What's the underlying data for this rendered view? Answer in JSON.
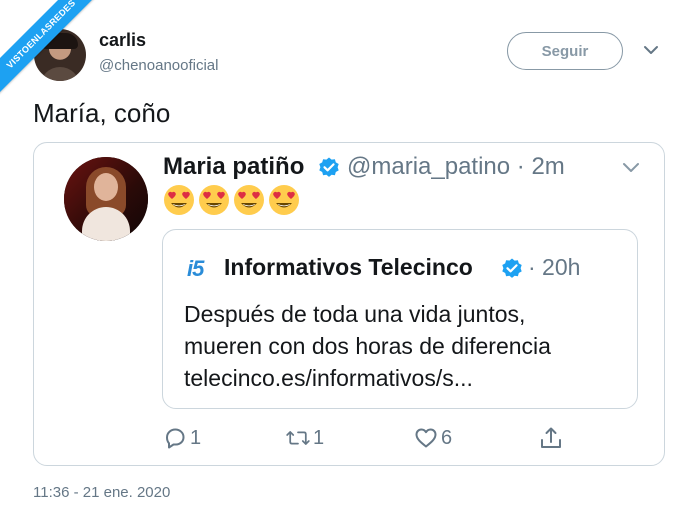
{
  "watermark": "VISTOENLASREDES",
  "tweet": {
    "author_name": "carlis",
    "author_handle": "@chenoanooficial",
    "follow_label": "Seguir",
    "text": "María, coño",
    "timestamp": "11:36 - 21 ene. 2020"
  },
  "quoted": {
    "author_name": "Maria patiño",
    "author_handle": "@maria_patino · 2m",
    "emojis": [
      "😍",
      "😍",
      "😍",
      "😍"
    ],
    "inner": {
      "logo": "i5",
      "author_name": "Informativos Telecinco",
      "time": "· 20h",
      "lines": [
        "Después de toda una vida juntos,",
        "mueren con dos horas de diferencia",
        "telecinco.es/informativos/s..."
      ]
    },
    "actions": {
      "replies": "1",
      "retweets": "1",
      "likes": "6"
    }
  },
  "colors": {
    "verified": "#1da1f2",
    "secondary_text": "#657786",
    "border": "#ccd6dd",
    "follow_border": "#8899a6"
  },
  "icons": [
    "chevron-down-icon",
    "verified-icon",
    "reply-icon",
    "retweet-icon",
    "like-icon",
    "share-icon"
  ]
}
